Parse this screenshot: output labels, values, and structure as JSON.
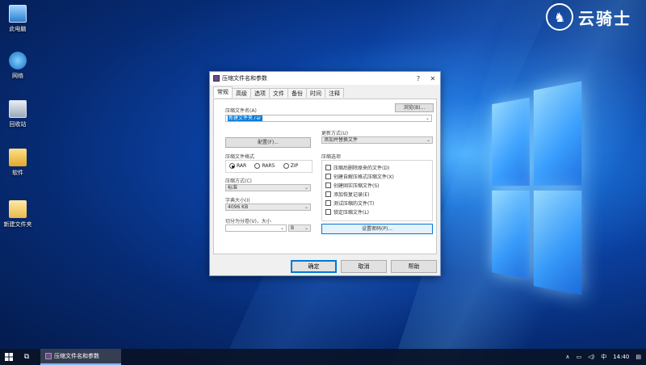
{
  "desktop": {
    "icons": [
      {
        "label": "此电脑",
        "icon": "computer-icon"
      },
      {
        "label": "网络",
        "icon": "network-icon"
      },
      {
        "label": "回收站",
        "icon": "recycle-bin-icon"
      },
      {
        "label": "软件",
        "icon": "folder-icon"
      },
      {
        "label": "新建文件夹",
        "icon": "folder-icon"
      }
    ],
    "watermark": "云骑士"
  },
  "dialog": {
    "title": "压缩文件名和参数",
    "tabs": [
      "常规",
      "高级",
      "选项",
      "文件",
      "备份",
      "时间",
      "注释"
    ],
    "archive_name_label": "压缩文件名(A)",
    "archive_name_value": "新建文件夹.rar",
    "browse_button": "浏览(B)...",
    "update_mode_label": "更新方式(U)",
    "update_mode_value": "添加并替换文件",
    "profile_button": "配置(F)...",
    "format_label": "压缩文件格式",
    "formats": [
      "RAR",
      "RAR5",
      "ZIP"
    ],
    "selected_format": "RAR",
    "method_label": "压缩方式(C)",
    "method_value": "标准",
    "dict_label": "字典大小(I)",
    "dict_value": "4096 KB",
    "split_label": "切分为分卷(V)，大小",
    "split_unit": "B",
    "options_label": "压缩选项",
    "options": [
      "压缩后删除原来的文件(D)",
      "创建自解压格式压缩文件(X)",
      "创建固实压缩文件(S)",
      "添加恢复记录(E)",
      "测试压缩的文件(T)",
      "锁定压缩文件(L)"
    ],
    "set_password_button": "设置密码(P)...",
    "ok_button": "确定",
    "cancel_button": "取消",
    "help_button": "帮助"
  },
  "taskbar": {
    "app_label": "压缩文件名和参数",
    "ime": "中",
    "clock": "14:40"
  },
  "colors": {
    "accent": "#0078d7",
    "taskbar": "#0a1428",
    "desktop": "#0b3f9e"
  }
}
